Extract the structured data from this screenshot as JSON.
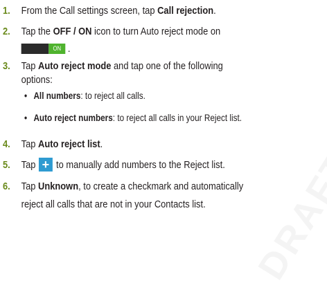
{
  "watermark": "DRAFT",
  "steps": [
    {
      "num": "1.",
      "pre": "From the Call settings screen, tap ",
      "bold": "Call rejection",
      "post": "."
    },
    {
      "num": "2.",
      "pre": "Tap the ",
      "bold": "OFF / ON",
      "post": " icon to turn Auto reject mode on",
      "toggle_on_label": "ON",
      "line2_post": " ."
    },
    {
      "num": "3.",
      "pre": "Tap ",
      "bold": "Auto reject mode",
      "post": " and tap one of the following",
      "line2": "options:"
    },
    {
      "num": "4.",
      "pre": "Tap ",
      "bold": "Auto reject list",
      "post": "."
    },
    {
      "num": "5.",
      "pre": "Tap ",
      "icon": "plus-icon",
      "icon_glyph": "+",
      "post": " to manually add numbers to the Reject list."
    },
    {
      "num": "6.",
      "pre": "Tap ",
      "bold": "Unknown",
      "post": ", to create a checkmark and automatically",
      "line2": "reject all calls that are not in your Contacts list."
    }
  ],
  "options": [
    {
      "bullet": "•",
      "bold": "All numbers",
      "text": ": to reject all calls."
    },
    {
      "bullet": "•",
      "bold": "Auto reject numbers",
      "text": ": to reject all calls in your Reject list."
    }
  ],
  "colors": {
    "step_number": "#6a8a1b",
    "toggle_on": "#4fb32e",
    "toggle_off": "#2b2b2b",
    "plus_button": "#2f9bd1"
  }
}
